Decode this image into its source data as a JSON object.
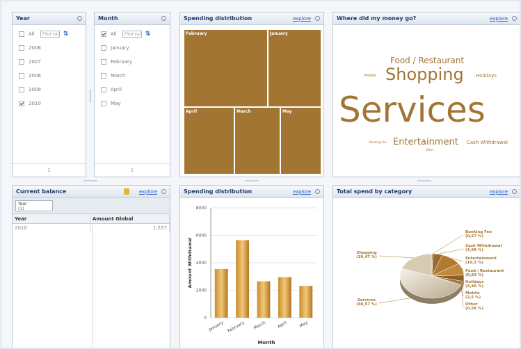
{
  "year_panel": {
    "title": "Year",
    "all_label": "All",
    "find_placeholder": "Find val",
    "items": [
      {
        "label": "2006",
        "checked": false
      },
      {
        "label": "2007",
        "checked": false
      },
      {
        "label": "2008",
        "checked": false
      },
      {
        "label": "2009",
        "checked": false
      },
      {
        "label": "2010",
        "checked": true
      }
    ],
    "page": "1"
  },
  "month_panel": {
    "title": "Month",
    "all_label": "All",
    "find_placeholder": "Find val",
    "items": [
      {
        "label": "January",
        "checked": false
      },
      {
        "label": "February",
        "checked": false
      },
      {
        "label": "March",
        "checked": false
      },
      {
        "label": "April",
        "checked": false
      },
      {
        "label": "May",
        "checked": false
      }
    ],
    "page": "1"
  },
  "treemap_panel": {
    "title": "Spending distribution",
    "explore": "explore",
    "cells": [
      "February",
      "January",
      "April",
      "March",
      "May"
    ]
  },
  "wordcloud_panel": {
    "title": "Where did my money go?",
    "explore": "explore",
    "words": [
      "Food / Restaurant",
      "Mobile",
      "Shopping",
      "Holidays",
      "Services",
      "Banking Fee",
      "Entertainment",
      "Cash Withdrawal",
      "Other"
    ]
  },
  "balance_panel": {
    "title": "Current balance",
    "explore": "explore",
    "tag_label": "Year",
    "tag_count": "(1)",
    "columns": [
      "Year",
      "Amount Global"
    ],
    "rows": [
      [
        "2010",
        "1,557"
      ]
    ]
  },
  "bar_panel": {
    "title": "Spending distribution",
    "explore": "explore"
  },
  "pie_panel": {
    "title": "Total spend by category",
    "explore": "explore"
  },
  "colors": {
    "accent": "#a37533",
    "header_text": "#1f3a66",
    "link": "#2a62c9"
  },
  "chart_data": [
    {
      "type": "bar",
      "title": "",
      "xlabel": "Month",
      "ylabel": "Amount Withdrawal",
      "categories": [
        "January",
        "February",
        "March",
        "April",
        "May"
      ],
      "values": [
        3550,
        5650,
        2650,
        2950,
        2320
      ],
      "ylim": [
        0,
        8000
      ],
      "yticks": [
        "0",
        "2000",
        "4000",
        "6000",
        "8000"
      ],
      "grid": true
    },
    {
      "type": "pie",
      "labels": [
        "Banking Fee",
        "Cash Withdrawal",
        "Entertainment",
        "Food / Restaurant",
        "Holidays",
        "Mobile",
        "Other",
        "Services",
        "Shopping"
      ],
      "label_text": [
        "Banking Fee\n(0,57 %)",
        "Cash Withdrawal\n(4,69 %)",
        "Entertainment\n(10,3 %)",
        "Food / Restaurant\n(8,83 %)",
        "Holidays\n(4,46 %)",
        "Mobile\n(2,5 %)",
        "Other\n(0,58 %)",
        "Services\n(48,57 %)",
        "Shopping\n(19,47 %)"
      ],
      "values": [
        0.57,
        4.69,
        10.3,
        8.83,
        4.46,
        2.5,
        0.58,
        48.57,
        19.47
      ],
      "legend": "none"
    }
  ]
}
